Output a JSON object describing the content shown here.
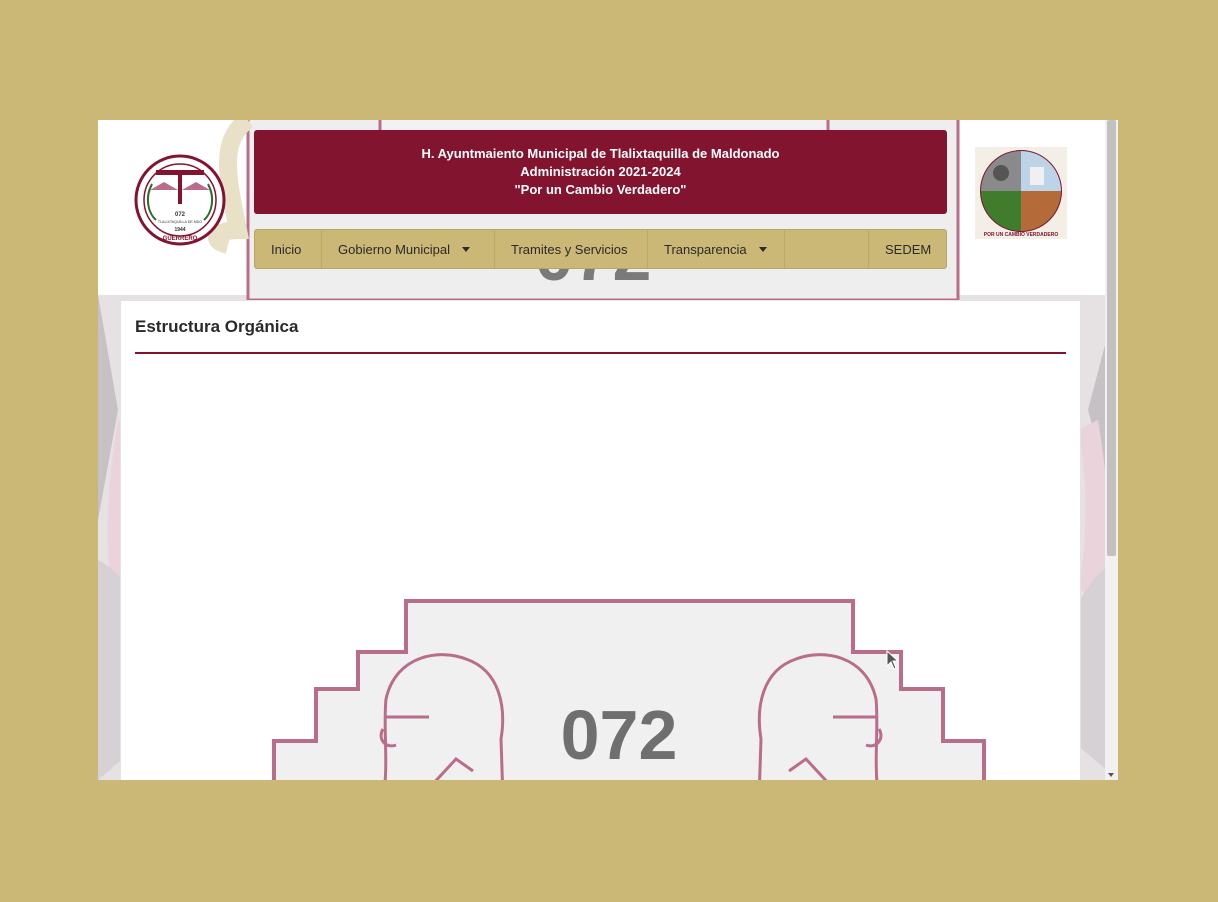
{
  "header": {
    "line1": "H. Ayuntmaiento Municipal de Tlalixtaquilla de Maldonado",
    "line2": "Administración 2021-2024",
    "line3": "\"Por un Cambio Verdadero\""
  },
  "left_logo": {
    "number": "072",
    "caption": "TLALIXTAQUILLA DE MDO",
    "year": "1944",
    "state": "GUERRERO"
  },
  "right_logo": {
    "caption": "POR UN CAMBIO VERDADERO"
  },
  "nav": {
    "items": [
      {
        "label": "Inicio",
        "dropdown": false
      },
      {
        "label": "Gobierno Municipal",
        "dropdown": true
      },
      {
        "label": "Tramites y Servicios",
        "dropdown": false
      },
      {
        "label": "Transparencia",
        "dropdown": true
      },
      {
        "label": "",
        "dropdown": false
      },
      {
        "label": "SEDEM",
        "dropdown": false
      }
    ]
  },
  "main": {
    "title": "Estructura Orgánica"
  },
  "emblem": {
    "number": "072"
  },
  "colors": {
    "page_bg": "#cbb776",
    "brand": "#821430",
    "nav_bg": "#cbb776",
    "emblem_outline": "#b86d8b"
  }
}
